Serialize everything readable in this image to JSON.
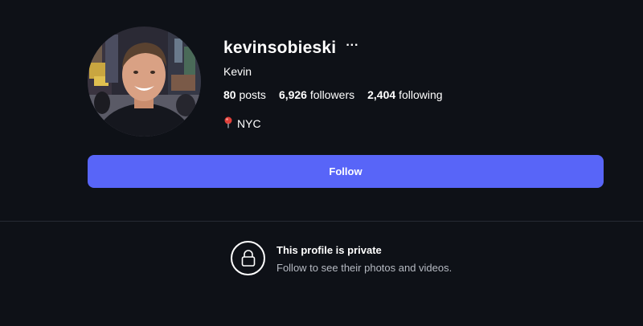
{
  "profile": {
    "username": "kevinsobieski",
    "more_label": "···",
    "full_name": "Kevin",
    "stats": {
      "posts_count": "80",
      "posts_label": "posts",
      "followers_count": "6,926",
      "followers_label": "followers",
      "following_count": "2,404",
      "following_label": "following"
    },
    "location": "NYC",
    "location_icon": "pin-icon"
  },
  "actions": {
    "follow_label": "Follow"
  },
  "private_notice": {
    "title": "This profile is private",
    "subtitle": "Follow to see their photos and videos.",
    "icon": "lock-icon"
  },
  "colors": {
    "background": "#0e1117",
    "accent": "#5865f8",
    "text_primary": "#ffffff",
    "text_secondary": "#b6bac2",
    "divider": "#262a33"
  }
}
